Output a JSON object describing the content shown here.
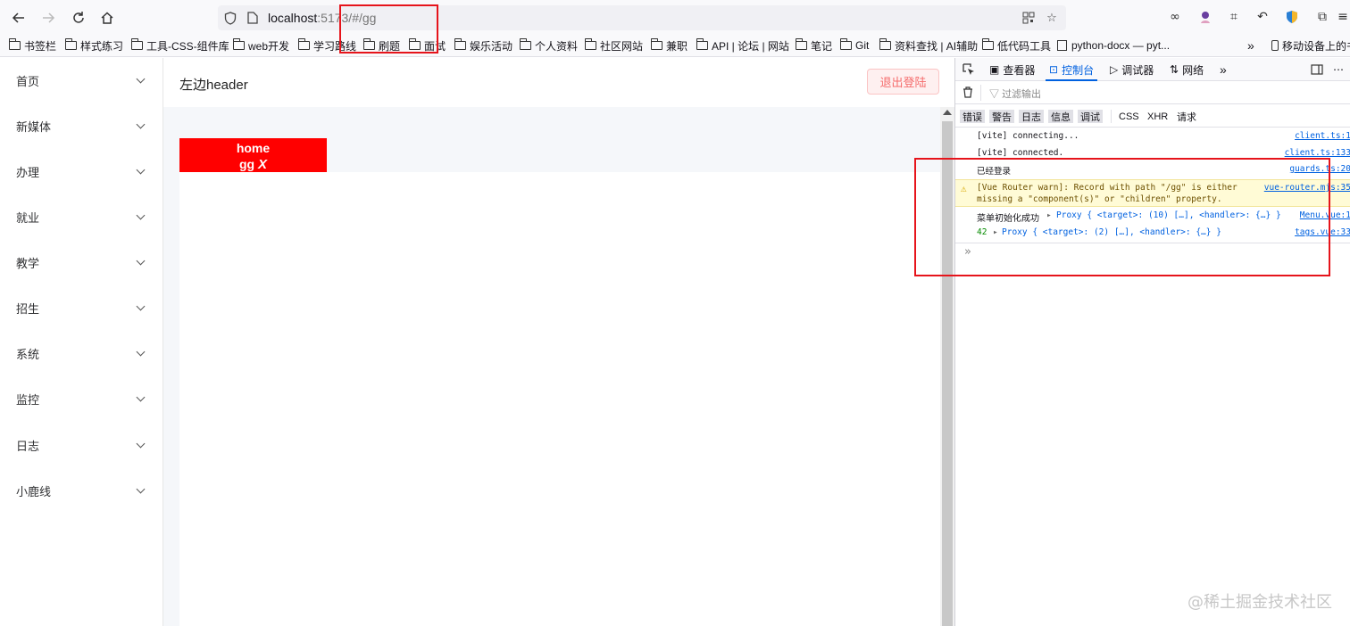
{
  "browser": {
    "url_host": "localhost",
    "url_rest": ":5173/#/gg",
    "bookmarks": [
      "书签栏",
      "样式练习",
      "工具-CSS-组件库",
      "web开发",
      "学习路线",
      "刷题",
      "面试",
      "娱乐活动",
      "个人资料",
      "社区网站",
      "兼职",
      "API | 论坛 | 网站",
      "笔记",
      "Git",
      "资料查找 | AI辅助",
      "低代码工具",
      "python-docx — pyt...",
      "移动设备上的书"
    ],
    "overflow_label": "»"
  },
  "sidebar": {
    "items": [
      "首页",
      "新媒体",
      "办理",
      "就业",
      "教学",
      "招生",
      "系统",
      "监控",
      "日志",
      "小鹿线"
    ]
  },
  "header": {
    "title": "左边header",
    "logout_label": "退出登陆"
  },
  "tag": {
    "line1": "home",
    "line2": "gg",
    "close": "X"
  },
  "devtools": {
    "tabs": [
      "查看器",
      "控制台",
      "调试器",
      "网络"
    ],
    "filter_placeholder": "过滤输出",
    "categories": [
      "错误",
      "警告",
      "日志",
      "信息",
      "调试",
      "CSS",
      "XHR",
      "请求"
    ],
    "logs": {
      "l1_text": "[vite] connecting...",
      "l1_src": "client.ts:1",
      "l2_text": "[vite] connected.",
      "l2_src": "client.ts:133",
      "l3_text": "已经登录",
      "l3_src": "guards.ts:20",
      "warn_line1": "[Vue Router warn]: Record with path \"/gg\" is either",
      "warn_line2": "missing a \"component(s)\" or \"children\" property.",
      "warn_src": "vue-router.mjs:35",
      "l5_label": "菜单初始化成功",
      "l5_obj": "Proxy { <target>: (10) […], <handler>: {…} }",
      "l5_src": "Menu.vue:1",
      "l6_num": "42",
      "l6_obj": "Proxy { <target>: (2) […], <handler>: {…} }",
      "l6_src": "tags.vue:33"
    }
  },
  "watermark": "@稀土掘金技术社区",
  "colors": {
    "highlight": "#e6141b",
    "tag_bg": "#ff0000",
    "devtools_accent": "#0061e0",
    "logout_text": "#f56c6c"
  }
}
